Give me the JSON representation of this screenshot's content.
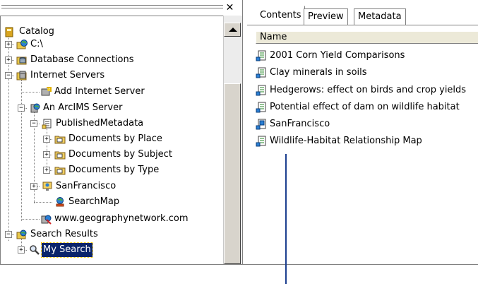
{
  "tree": {
    "items": [
      {
        "label": "Catalog",
        "icon": "catalog-icon"
      },
      {
        "label": "C:\\",
        "icon": "folder-connection-icon"
      },
      {
        "label": "Database Connections",
        "icon": "database-connections-icon"
      },
      {
        "label": "Internet Servers",
        "icon": "internet-servers-icon"
      },
      {
        "label": "Add Internet Server",
        "icon": "add-server-icon"
      },
      {
        "label": "An ArcIMS Server",
        "icon": "arcims-server-icon"
      },
      {
        "label": "PublishedMetadata",
        "icon": "metadata-service-icon"
      },
      {
        "label": "Documents by Place",
        "icon": "folder-icon"
      },
      {
        "label": "Documents by Subject",
        "icon": "folder-icon"
      },
      {
        "label": "Documents by Type",
        "icon": "folder-icon"
      },
      {
        "label": "SanFrancisco",
        "icon": "map-service-icon"
      },
      {
        "label": "SearchMap",
        "icon": "search-map-icon"
      },
      {
        "label": "www.geographynetwork.com",
        "icon": "server-icon"
      },
      {
        "label": "Search Results",
        "icon": "search-results-icon"
      },
      {
        "label": "My Search",
        "icon": "magnifier-icon"
      }
    ],
    "selected_label": "My Search"
  },
  "tabs": [
    {
      "label": "Contents",
      "active": true
    },
    {
      "label": "Preview",
      "active": false
    },
    {
      "label": "Metadata",
      "active": false
    }
  ],
  "list": {
    "column_header": "Name",
    "rows": [
      {
        "label": "2001 Corn Yield Comparisons",
        "icon": "metadata-document-icon"
      },
      {
        "label": "Clay minerals in soils",
        "icon": "metadata-document-icon"
      },
      {
        "label": "Hedgerows: effect on birds and crop yields",
        "icon": "metadata-document-icon"
      },
      {
        "label": "Potential effect of dam on wildlife habitat",
        "icon": "metadata-document-icon"
      },
      {
        "label": "SanFrancisco",
        "icon": "map-document-icon"
      },
      {
        "label": "Wildlife-Habitat Relationship Map",
        "icon": "metadata-document-icon"
      }
    ]
  },
  "colors": {
    "selection": "#0a246a",
    "pointer_line": "#1c3f8f"
  }
}
